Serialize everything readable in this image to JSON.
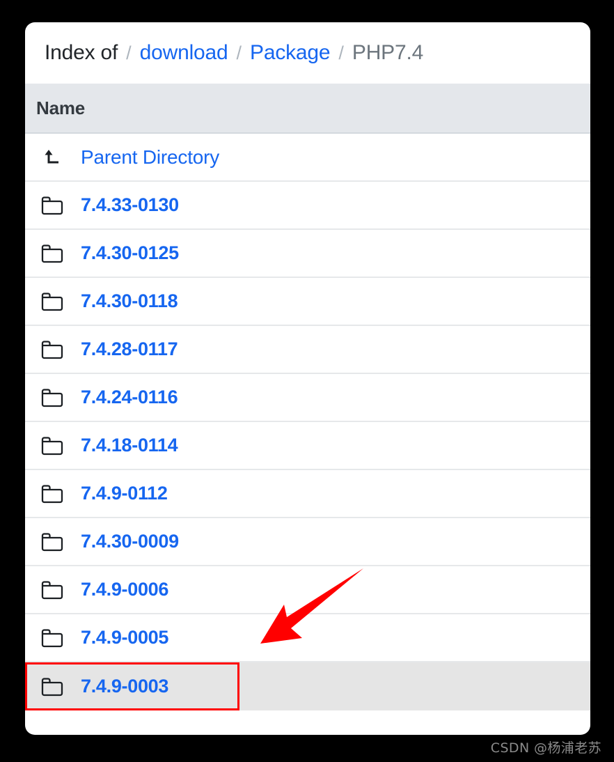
{
  "page": {
    "background_color": "#000000",
    "card_background": "#ffffff"
  },
  "breadcrumb": {
    "title": "Index of",
    "separator": "/",
    "items": [
      {
        "label": "download",
        "type": "link"
      },
      {
        "label": "Package",
        "type": "link"
      },
      {
        "label": "PHP7.4",
        "type": "current"
      }
    ],
    "link_color": "#1666f0",
    "current_color": "#6c757d"
  },
  "listing": {
    "columns": [
      "Name"
    ],
    "header_background": "#e4e7eb",
    "parent": {
      "label": "Parent Directory",
      "icon": "arrow-up-left-icon"
    },
    "rows": [
      {
        "name": "7.4.33-0130",
        "icon": "folder-icon",
        "selected": false
      },
      {
        "name": "7.4.30-0125",
        "icon": "folder-icon",
        "selected": false
      },
      {
        "name": "7.4.30-0118",
        "icon": "folder-icon",
        "selected": false
      },
      {
        "name": "7.4.28-0117",
        "icon": "folder-icon",
        "selected": false
      },
      {
        "name": "7.4.24-0116",
        "icon": "folder-icon",
        "selected": false
      },
      {
        "name": "7.4.18-0114",
        "icon": "folder-icon",
        "selected": false
      },
      {
        "name": "7.4.9-0112",
        "icon": "folder-icon",
        "selected": false
      },
      {
        "name": "7.4.30-0009",
        "icon": "folder-icon",
        "selected": false
      },
      {
        "name": "7.4.9-0006",
        "icon": "folder-icon",
        "selected": false
      },
      {
        "name": "7.4.9-0005",
        "icon": "folder-icon",
        "selected": false
      },
      {
        "name": "7.4.9-0003",
        "icon": "folder-icon",
        "selected": true
      }
    ]
  },
  "annotations": {
    "arrow": {
      "name": "red-arrow-annotation",
      "color": "#ff0000",
      "points_to": "7.4.9-0003"
    },
    "highlight_box": {
      "name": "red-highlight-box",
      "color": "#ff0000",
      "target": "7.4.9-0003"
    }
  },
  "watermark": {
    "text": "CSDN @杨浦老苏"
  }
}
